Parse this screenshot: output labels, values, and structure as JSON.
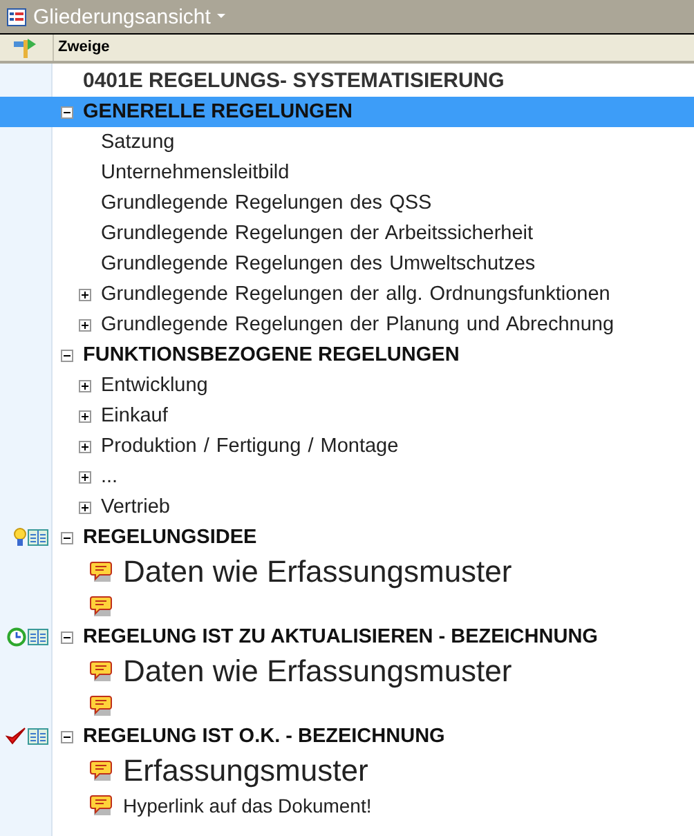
{
  "view_menu": {
    "label": "Gliederungsansicht"
  },
  "column_header": "Zweige",
  "root": "0401E REGELUNGS- SYSTEMATISIERUNG",
  "sections": [
    {
      "kind": "plain",
      "text": "GENERELLE REGELUNGEN",
      "selected": true,
      "expanded": true,
      "children": [
        {
          "kind": "item",
          "text": "Satzung"
        },
        {
          "kind": "item",
          "text": "Unternehmensleitbild"
        },
        {
          "kind": "item",
          "text": "Grundlegende Regelungen des QSS"
        },
        {
          "kind": "item",
          "text": "Grundlegende Regelungen der Arbeitssicherheit"
        },
        {
          "kind": "item",
          "text": "Grundlegende Regelungen des Umweltschutzes"
        },
        {
          "kind": "item",
          "text": "Grundlegende Regelungen der allg. Ordnungsfunktionen",
          "expanded": false
        },
        {
          "kind": "item",
          "text": "Grundlegende Regelungen der Planung und Abrechnung",
          "expanded": false
        }
      ]
    },
    {
      "kind": "plain",
      "text": "FUNKTIONSBEZOGENE REGELUNGEN",
      "selected": false,
      "expanded": true,
      "children": [
        {
          "kind": "item",
          "text": "Entwicklung",
          "expanded": false
        },
        {
          "kind": "item",
          "text": "Einkauf",
          "expanded": false
        },
        {
          "kind": "item",
          "text": "Produktion / Fertigung / Montage",
          "expanded": false
        },
        {
          "kind": "item",
          "text": "...",
          "expanded": false
        },
        {
          "kind": "item",
          "text": "Vertrieb",
          "expanded": false
        }
      ]
    },
    {
      "kind": "idea",
      "text": "REGELUNGSIDEE",
      "selected": false,
      "expanded": true,
      "children": [
        {
          "kind": "large_note",
          "text": "Daten wie Erfassungsmuster"
        },
        {
          "kind": "note"
        }
      ]
    },
    {
      "kind": "update",
      "text": "REGELUNG IST ZU AKTUALISIEREN - BEZEICHNUNG",
      "selected": false,
      "expanded": true,
      "children": [
        {
          "kind": "large_note",
          "text": "Daten wie Erfassungsmuster"
        },
        {
          "kind": "note"
        }
      ]
    },
    {
      "kind": "ok",
      "text": "REGELUNG IST O.K. - BEZEICHNUNG",
      "selected": false,
      "expanded": true,
      "children": [
        {
          "kind": "large_note",
          "text": "Erfassungsmuster"
        },
        {
          "kind": "note",
          "text": "Hyperlink auf das Dokument!"
        }
      ]
    }
  ]
}
